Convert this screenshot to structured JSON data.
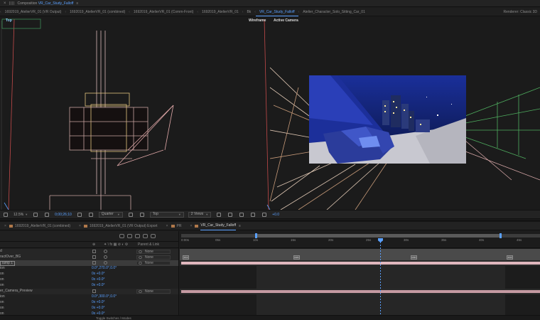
{
  "panel": {
    "close": "×",
    "title_prefix": "Composition",
    "title_comp": "VR_Car_Study_Falloff",
    "menu_icon": "≡"
  },
  "comp_tabs": [
    {
      "label": "1692019_AtelierVR_01 (VR Output)",
      "active": false
    },
    {
      "label": "1692019_AtelierVR_01 (combined)",
      "active": false
    },
    {
      "label": "1692019_AtelierVR_01 (Comm-Front)",
      "active": false
    },
    {
      "label": "1692019_AtelierVR_01",
      "active": false
    },
    {
      "label": "Bk",
      "active": false
    },
    {
      "label": "VR_Car_Study_Falloff",
      "active": true
    },
    {
      "label": "Atelier_Character_Solo_Sitting_Car_01",
      "active": false
    }
  ],
  "renderer": "Renderer:  Classic 3D",
  "viewer": {
    "top_label": "Top",
    "wireframe_label": "Wireframe",
    "camera_label": "Active Camera"
  },
  "view_bar": {
    "zoom": "12.5%",
    "timecode": "0;00;26;10",
    "resolution": "Quarter",
    "view": "Top",
    "layout": "2 Views",
    "exposure": "+0.0"
  },
  "timeline_tabs": [
    {
      "label": "1692019_AtelierVR_01 (combined)",
      "active": false
    },
    {
      "label": "1692019_AtelierVR_01 (VR Output) Export",
      "active": false
    },
    {
      "label": "PR",
      "active": false
    },
    {
      "label": "VR_Car_Study_Falloff",
      "active": true
    }
  ],
  "timeline_columns": {
    "pickwhip": "⊕",
    "switches": "✦ \\ fx ▦ ⊘ ◐ ⚙",
    "parent": "Parent & Link"
  },
  "ruler_ticks": [
    "0:00s",
    "05s",
    "10s",
    "15s",
    "20s",
    "25s",
    "30s",
    "35s",
    "40s",
    "45s"
  ],
  "layers": [
    {
      "name": "d",
      "type": "layer",
      "parent": "None"
    },
    {
      "name": "ractOver_BG",
      "type": "layer",
      "parent": "None"
    },
    {
      "name": "lamp 1",
      "type": "selected",
      "parent": "None"
    },
    {
      "name": "ion",
      "type": "prop",
      "value": "0.0°,270.0°,0.0°"
    },
    {
      "name": "on",
      "type": "prop",
      "value": "0x +0.0°"
    },
    {
      "name": "on",
      "type": "prop",
      "value": "0x +0.0°"
    },
    {
      "name": "on",
      "type": "prop",
      "value": "0x +0.0°"
    },
    {
      "name": "er_Camera_Preview",
      "type": "layer",
      "parent": "None"
    },
    {
      "name": "ion",
      "type": "prop",
      "value": "0.0°,300.0°,0.0°"
    },
    {
      "name": "on",
      "type": "prop",
      "value": "0x +0.0°"
    },
    {
      "name": "on",
      "type": "prop",
      "value": "0x +0.0°"
    },
    {
      "name": "on",
      "type": "prop",
      "value": "0x +0.0°"
    }
  ],
  "markers": [
    "M10",
    "M2D",
    "M3D",
    "M40"
  ],
  "footer": {
    "toggle": "Toggle Switches / Modes"
  },
  "colors": {
    "accent": "#5aa0ff",
    "panel_bg": "#1d1d1d",
    "layer_bar": "#c59aa2",
    "render_sky": "#1a2a80"
  }
}
